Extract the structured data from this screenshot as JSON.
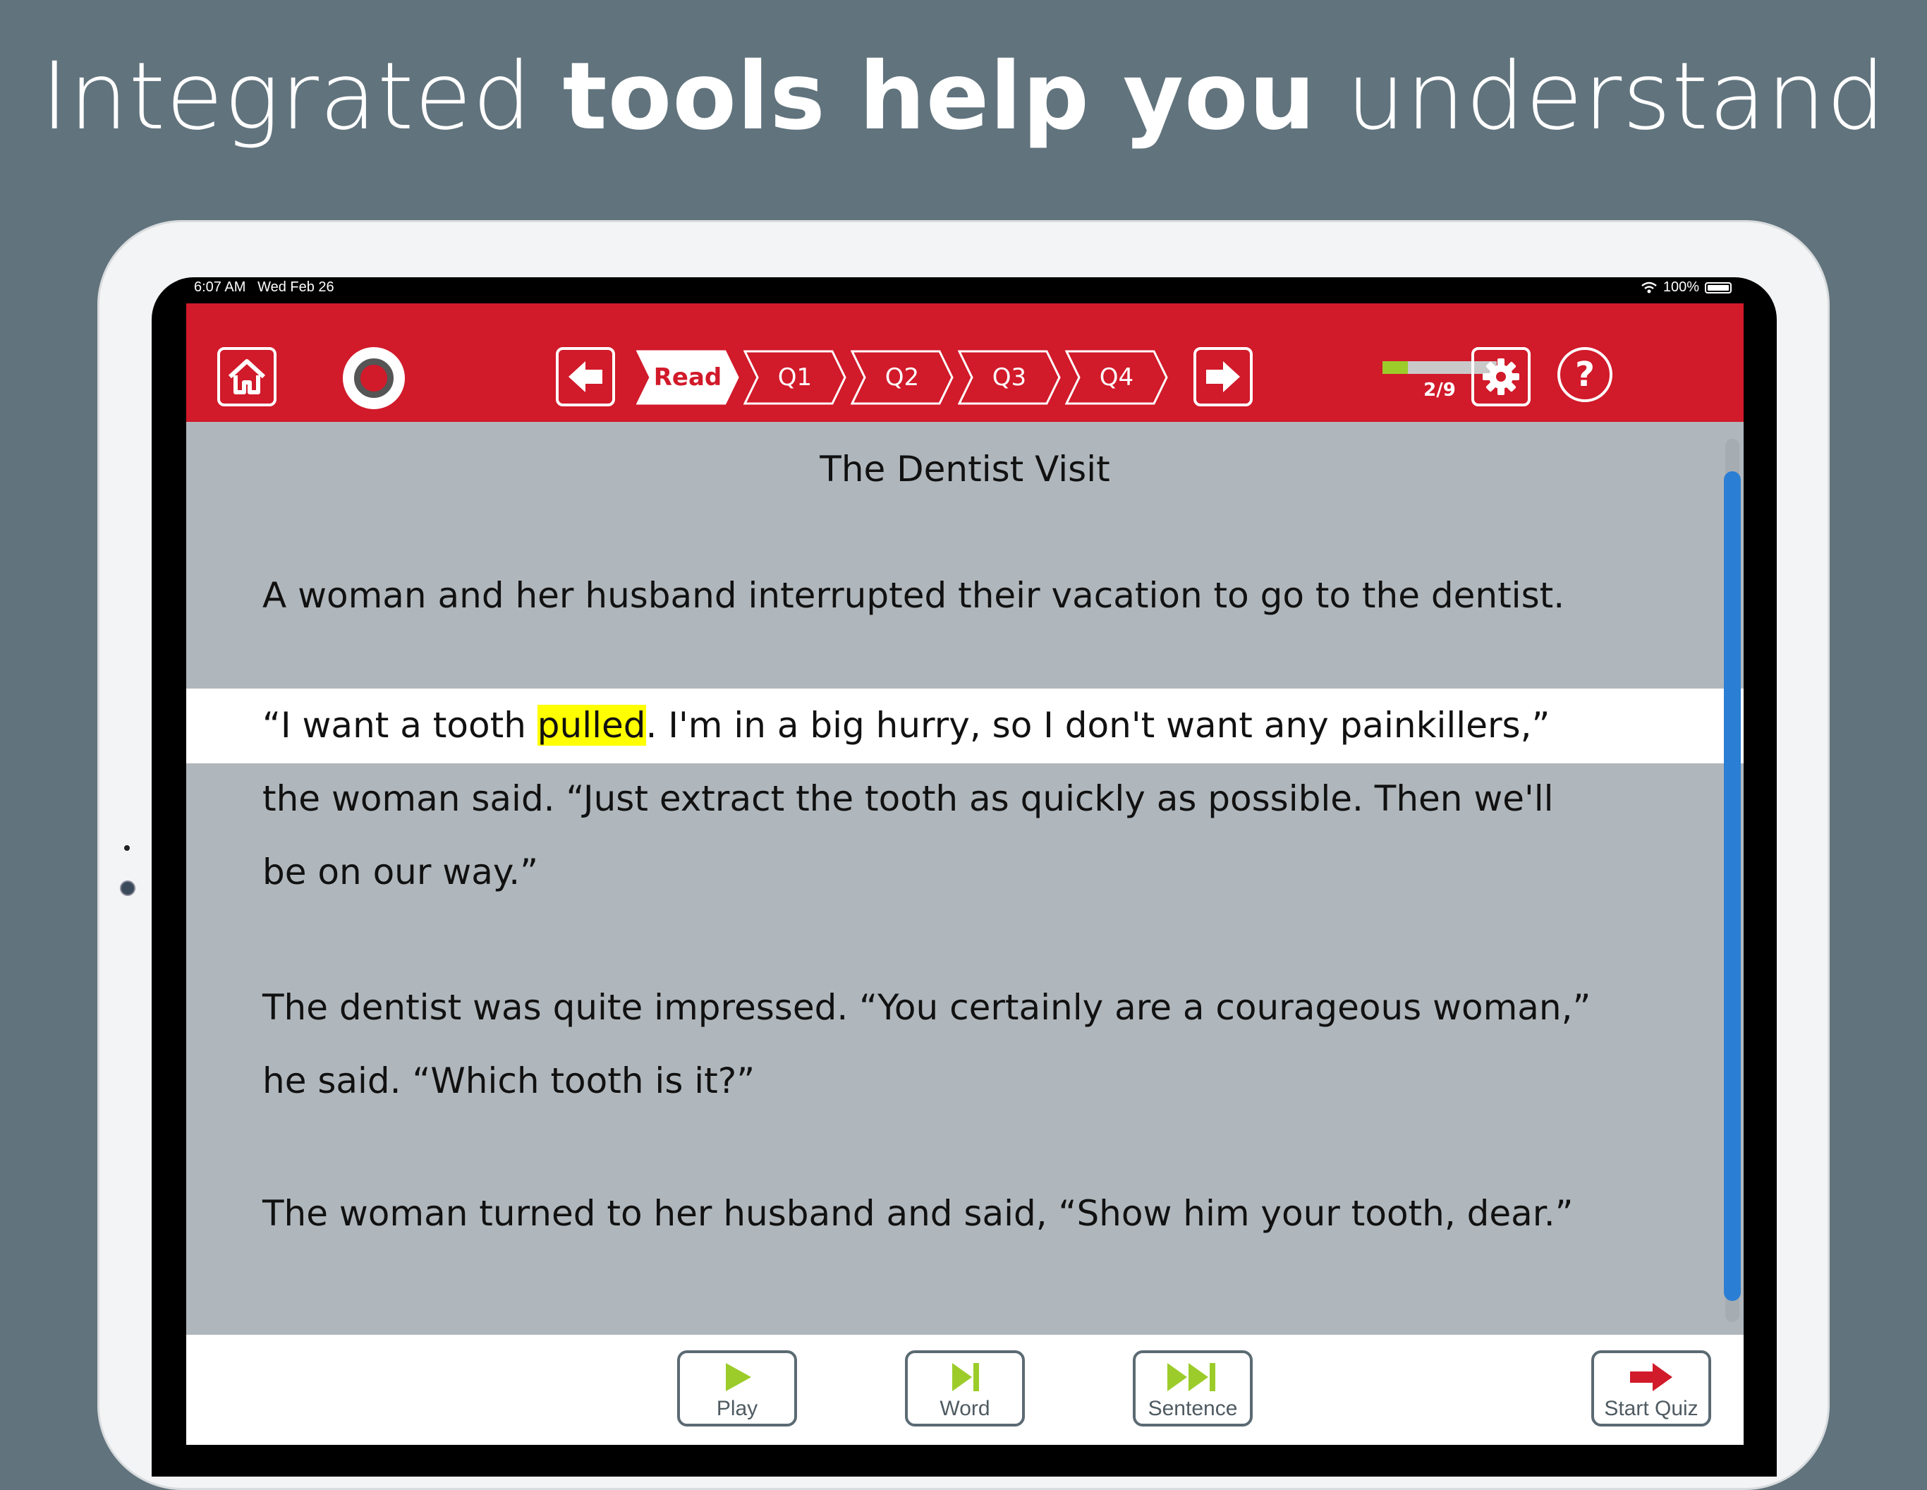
{
  "headline": {
    "part1": "Integrated ",
    "part2": "tools help you",
    "part3": " understand"
  },
  "status_bar": {
    "time": "6:07 AM",
    "date": "Wed Feb 26",
    "battery": "100%"
  },
  "toolbar": {
    "tabs": [
      {
        "label": "Read",
        "active": true
      },
      {
        "label": "Q1",
        "active": false
      },
      {
        "label": "Q2",
        "active": false
      },
      {
        "label": "Q3",
        "active": false
      },
      {
        "label": "Q4",
        "active": false
      }
    ],
    "progress_text": "2/9",
    "progress_fraction": 0.22,
    "help_label": "?"
  },
  "story": {
    "title": "The Dentist Visit",
    "p1": "A woman and her husband interrupted their vacation to go to the dentist.",
    "p2_before": "“I want a tooth ",
    "p2_highlight": "pulled",
    "p2_after": ". I'm in a big hurry, so I don't want any painkillers,”",
    "p2_line2": "the woman said. “Just extract the tooth as quickly as possible. Then we'll",
    "p2_line3": "be on our way.”",
    "p3_line1": "The dentist was quite impressed. “You certainly are a courageous woman,”",
    "p3_line2": "he said. “Which tooth is it?”",
    "p4": "The woman turned to her husband and said, “Show him your tooth, dear.”"
  },
  "footer": {
    "play_label": "Play",
    "word_label": "Word",
    "sentence_label": "Sentence",
    "quiz_label": "Start Quiz"
  },
  "colors": {
    "brand_red": "#d11a2a",
    "accent_green": "#9ccc2a",
    "highlight": "#ffff00",
    "scroll_blue": "#2a7fd4"
  }
}
